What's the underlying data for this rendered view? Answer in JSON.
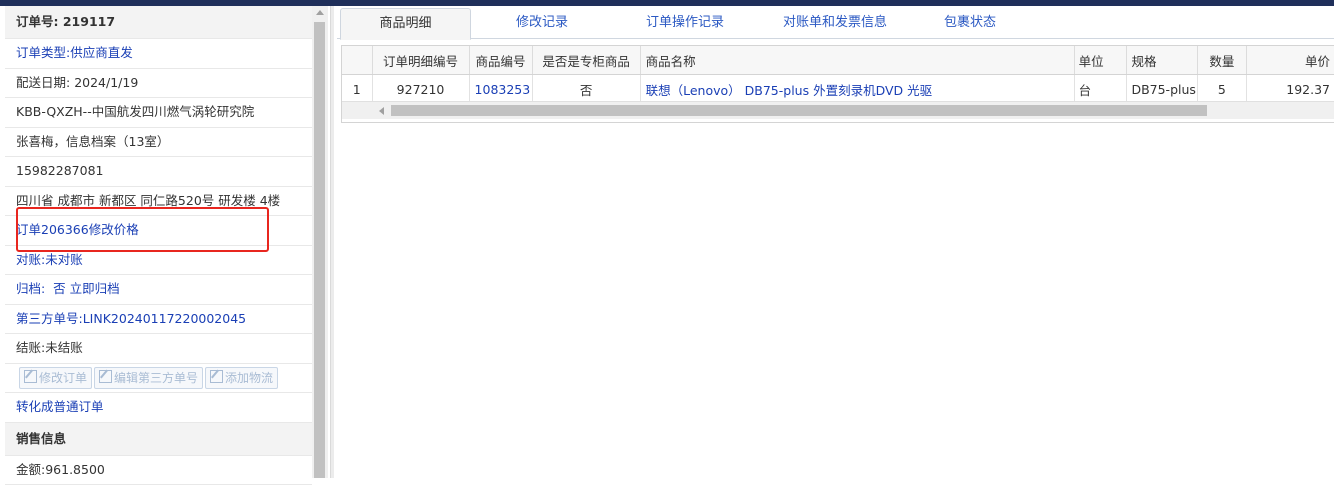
{
  "left_panel": {
    "order_no_label": "订单号:",
    "order_no": "219117",
    "order_type_label": "订单类型:",
    "order_type": "供应商直发",
    "delivery_date_label": "配送日期:",
    "delivery_date": "2024/1/19",
    "customer": "KBB-QXZH--中国航发四川燃气涡轮研究院",
    "contact": "张喜梅，信息档案（13室）",
    "phone": "15982287081",
    "address": "四川省 成都市 新都区 同仁路520号 研发楼 4楼",
    "modify_price_link": "订单206366修改价格",
    "reconcile_label": "对账:",
    "reconcile_value": "未对账",
    "archive_label": "归档:",
    "archive_value": "否",
    "archive_now_link": "立即归档",
    "third_party_label": "第三方单号:",
    "third_party_no": "LINK20240117220002045",
    "settle_label": "结账:",
    "settle_value": "未结账",
    "buttons": [
      "修改订单",
      "编辑第三方单号",
      "添加物流"
    ],
    "convert_link": "转化成普通订单",
    "sales_section_title": "销售信息",
    "amount_label": "金额:",
    "amount_value": "961.8500"
  },
  "tabs": [
    {
      "label": "商品明细",
      "active": true
    },
    {
      "label": "修改记录",
      "active": false
    },
    {
      "label": "订单操作记录",
      "active": false
    },
    {
      "label": "对账单和发票信息",
      "active": false
    },
    {
      "label": "包裹状态",
      "active": false
    }
  ],
  "table": {
    "headers": [
      "",
      "订单明细编号",
      "商品编号",
      "是否是专柜商品",
      "商品名称",
      "单位",
      "规格",
      "数量",
      "单价"
    ],
    "rows": [
      [
        "1",
        "927210",
        "1083253",
        "否",
        "联想（Lenovo） DB75-plus 外置刻录机DVD 光驱",
        "台",
        "DB75-plus",
        "5",
        "192.37"
      ]
    ]
  },
  "colors": {
    "link_blue": "#1a3fb5",
    "highlight_red": "#e8261f",
    "topbar": "#1f2f5a"
  }
}
